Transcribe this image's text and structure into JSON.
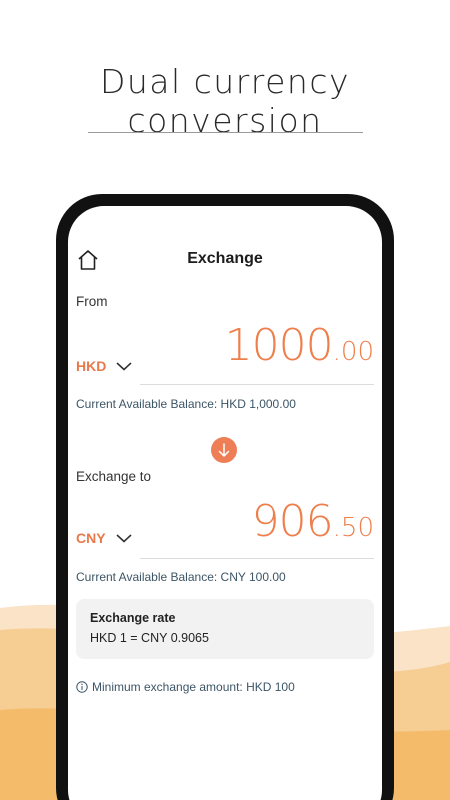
{
  "headline": "Dual currency conversion",
  "screen": {
    "title": "Exchange",
    "from": {
      "label": "From",
      "currency": "HKD",
      "amount_int": "1000",
      "amount_dec": ".00",
      "balance": "Current Available Balance: HKD 1,000.00"
    },
    "to": {
      "label": "Exchange to",
      "currency": "CNY",
      "amount_int": "906",
      "amount_dec": ".50",
      "balance": "Current Available Balance: CNY 100.00"
    },
    "rate": {
      "title": "Exchange rate",
      "value": "HKD 1 = CNY 0.9065"
    },
    "min_note": "Minimum exchange amount: HKD 100"
  },
  "icons": [
    "home-icon",
    "chevron-down-icon",
    "arrow-down-icon",
    "info-icon"
  ],
  "colors": {
    "accent": "#ee7f4c",
    "wave_light": "#f9dcb8",
    "wave_dark": "#f4b866",
    "phone_frame": "#111111"
  }
}
